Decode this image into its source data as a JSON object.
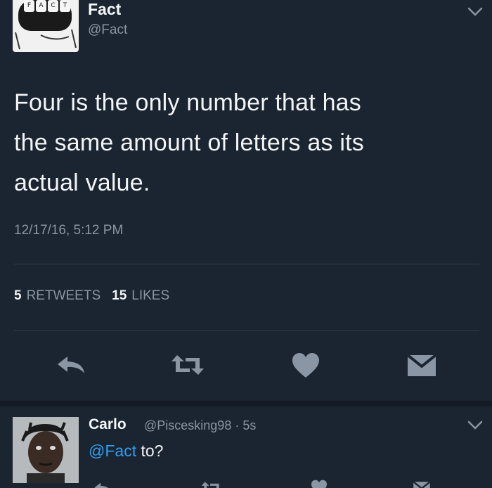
{
  "tweet": {
    "display_name": "Fact",
    "handle": "@Fact",
    "avatar_letters": [
      "F",
      "A",
      "C",
      "T"
    ],
    "text_lines": [
      "Four is the only number that has",
      "the same amount of letters as its",
      "actual value."
    ],
    "timestamp": "12/17/16, 5:12 PM",
    "retweets_count": "5",
    "retweets_label": "RETWEETS",
    "likes_count": "15",
    "likes_label": "LIKES"
  },
  "reply": {
    "display_name": "Carlo",
    "meta": "@Piscesking98 · 5s",
    "mention": "@Fact",
    "text": " to?"
  },
  "icons": {
    "reply": "reply-icon",
    "retweet": "retweet-icon",
    "like": "heart-icon",
    "dm": "envelope-icon",
    "more": "chevron-down-icon"
  },
  "colors": {
    "background": "#1b2431",
    "muted": "#8a96a3",
    "link": "#2f9ff0",
    "icon": "#8a96a3"
  }
}
